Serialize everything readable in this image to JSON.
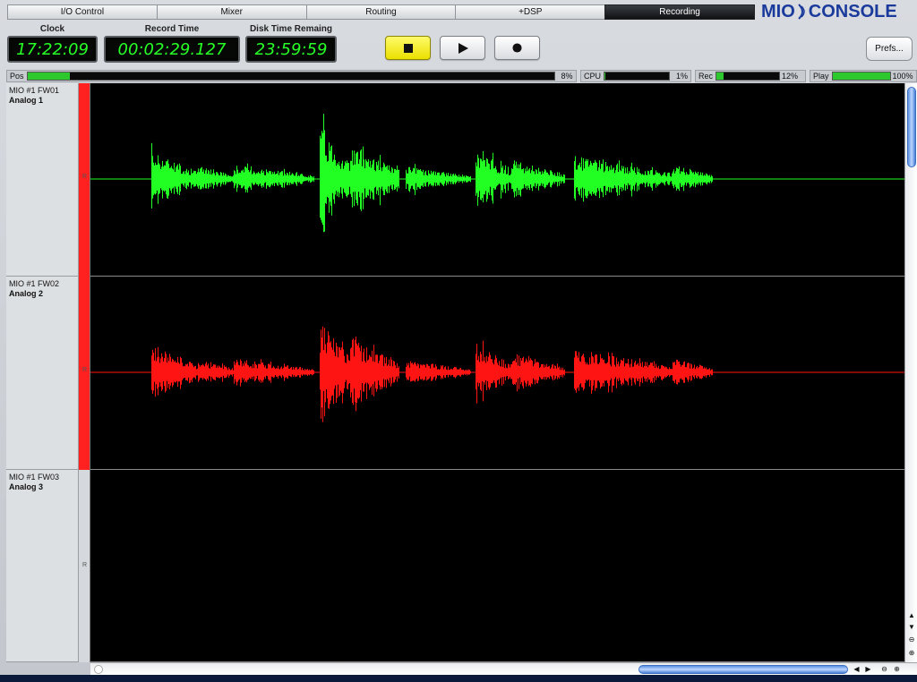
{
  "tabs": [
    {
      "label": "I/O Control",
      "active": false
    },
    {
      "label": "Mixer",
      "active": false
    },
    {
      "label": "Routing",
      "active": false
    },
    {
      "label": "+DSP",
      "active": false
    },
    {
      "label": "Recording",
      "active": true
    }
  ],
  "brand": {
    "left": "MIO",
    "right": "CONSOLE",
    "color": "#1a3a9c"
  },
  "displays": {
    "clock": {
      "label": "Clock",
      "value": "17:22:09"
    },
    "record_time": {
      "label": "Record Time",
      "value": "00:02:29.127"
    },
    "disk_time": {
      "label": "Disk Time Remaing",
      "value": "23:59:59"
    }
  },
  "transport": {
    "stop": {
      "icon": "stop-icon",
      "active": true,
      "active_color": "#f4ee1a"
    },
    "play": {
      "icon": "play-icon",
      "active": false
    },
    "record": {
      "icon": "record-icon",
      "active": false
    }
  },
  "prefs_label": "Prefs...",
  "meters": {
    "pos": {
      "label": "Pos",
      "value_text": "8%",
      "fraction": 0.08
    },
    "cpu": {
      "label": "CPU",
      "value_text": "1%",
      "fraction": 0.01
    },
    "rec": {
      "label": "Rec",
      "value_text": "12%",
      "fraction": 0.12
    },
    "play": {
      "label": "Play",
      "value_text": "100%",
      "fraction": 1.0
    }
  },
  "tracks": [
    {
      "device": "MIO #1 FW01",
      "channel": "Analog 1",
      "r_label": "R",
      "armed": true,
      "wave_color": "#22ff22",
      "has_audio": true
    },
    {
      "device": "MIO #1 FW02",
      "channel": "Analog 2",
      "r_label": "R",
      "armed": true,
      "wave_color": "#ff1414",
      "has_audio": true
    },
    {
      "device": "MIO #1 FW03",
      "channel": "Analog 3",
      "r_label": "R",
      "armed": false,
      "wave_color": "#22ff22",
      "has_audio": false
    }
  ],
  "colors": {
    "armed_strip": "#ff2020",
    "display_text": "#27ff27",
    "scroll_thumb": "#5a8fe0"
  },
  "icons": {
    "vscroll_up": "chevron-up-icon",
    "vscroll_down": "chevron-down-icon",
    "zoom_out": "zoom-out-icon",
    "zoom_in": "zoom-in-icon",
    "hscroll_left": "chevron-left-icon",
    "hscroll_right": "chevron-right-icon"
  }
}
